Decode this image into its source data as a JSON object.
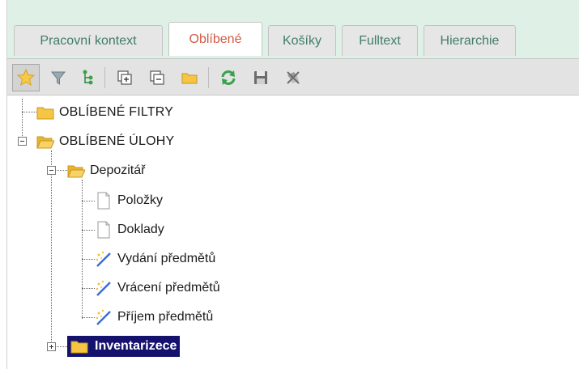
{
  "tabs": [
    {
      "label": "Pracovní kontext",
      "active": false
    },
    {
      "label": "Oblíbené",
      "active": true
    },
    {
      "label": "Košíky",
      "active": false
    },
    {
      "label": "Fulltext",
      "active": false
    },
    {
      "label": "Hierarchie",
      "active": false
    }
  ],
  "toolbar": {
    "buttons": [
      {
        "icon": "star-icon",
        "selected": true
      },
      {
        "icon": "filter-icon"
      },
      {
        "icon": "tree-structure-icon"
      },
      {
        "icon": "expand-all-icon"
      },
      {
        "icon": "collapse-all-icon"
      },
      {
        "icon": "folder-icon"
      },
      {
        "icon": "refresh-icon"
      },
      {
        "icon": "save-icon"
      },
      {
        "icon": "remove-icon"
      }
    ]
  },
  "tree": {
    "favorite_filters": "OBLÍBENÉ FILTRY",
    "favorite_tasks": "OBLÍBENÉ ÚLOHY",
    "depository": "Depozitář",
    "items": "Položky",
    "documents": "Doklady",
    "issue": "Vydání předmětů",
    "return": "Vrácení předmětů",
    "receipt": "Příjem předmětů",
    "inventory": "Inventarizece"
  },
  "colors": {
    "tab_active_text": "#d15b45",
    "tab_text": "#3f7d68",
    "tab_strip_bg": "#dff1e7",
    "selection_bg": "#15126e",
    "folder": "#f6c543"
  }
}
